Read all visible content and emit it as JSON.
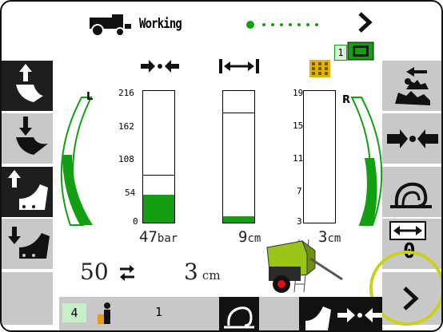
{
  "status": {
    "mode_label": "Working",
    "page_dots_total": 8,
    "page_dot_active": 1,
    "tractor_icon": "tractor-icon",
    "next_icon": "chevron-right-icon",
    "implement_number": "1"
  },
  "left_gauge": {
    "label": "L",
    "level": 0.6
  },
  "right_gauge": {
    "label": "R",
    "level": 0.3
  },
  "bars": [
    {
      "name": "pressure",
      "icon": "compress-icon",
      "ticks": [
        "216",
        "162",
        "108",
        "54",
        "0"
      ],
      "fill": 0.21,
      "marker": 0.36,
      "value": "47",
      "unit": "bar"
    },
    {
      "name": "width",
      "icon": "width-icon",
      "ticks": [],
      "fill": 0.05,
      "marker": 0.83,
      "value": "9",
      "unit": "cm"
    },
    {
      "name": "right",
      "icon": "grid-icon",
      "ticks": [
        "19",
        "15",
        "11",
        "7",
        "3"
      ],
      "fill": 0.0,
      "marker": 0.0,
      "value": "3",
      "unit": "cm"
    }
  ],
  "bottom_readouts": {
    "count_value": "50",
    "count_icon": "swap-icon",
    "distance_value": "3",
    "distance_unit": "cm"
  },
  "left_buttons": [
    "raise-tip-icon",
    "lower-tip-icon",
    "raise-gate-icon",
    "lower-gate-icon",
    ""
  ],
  "right_buttons": [
    "lift-unload-icon",
    "compress-icon",
    "net-wrap-icon",
    "width-zero-icon",
    "chevron-right-icon"
  ],
  "right_button_value": "0",
  "footer": {
    "counter_box": "4",
    "operator_icon": "operator-icon",
    "operator_value": "1"
  },
  "colors": {
    "accent_green": "#12a012",
    "highlight_ring": "#c7d11e"
  }
}
